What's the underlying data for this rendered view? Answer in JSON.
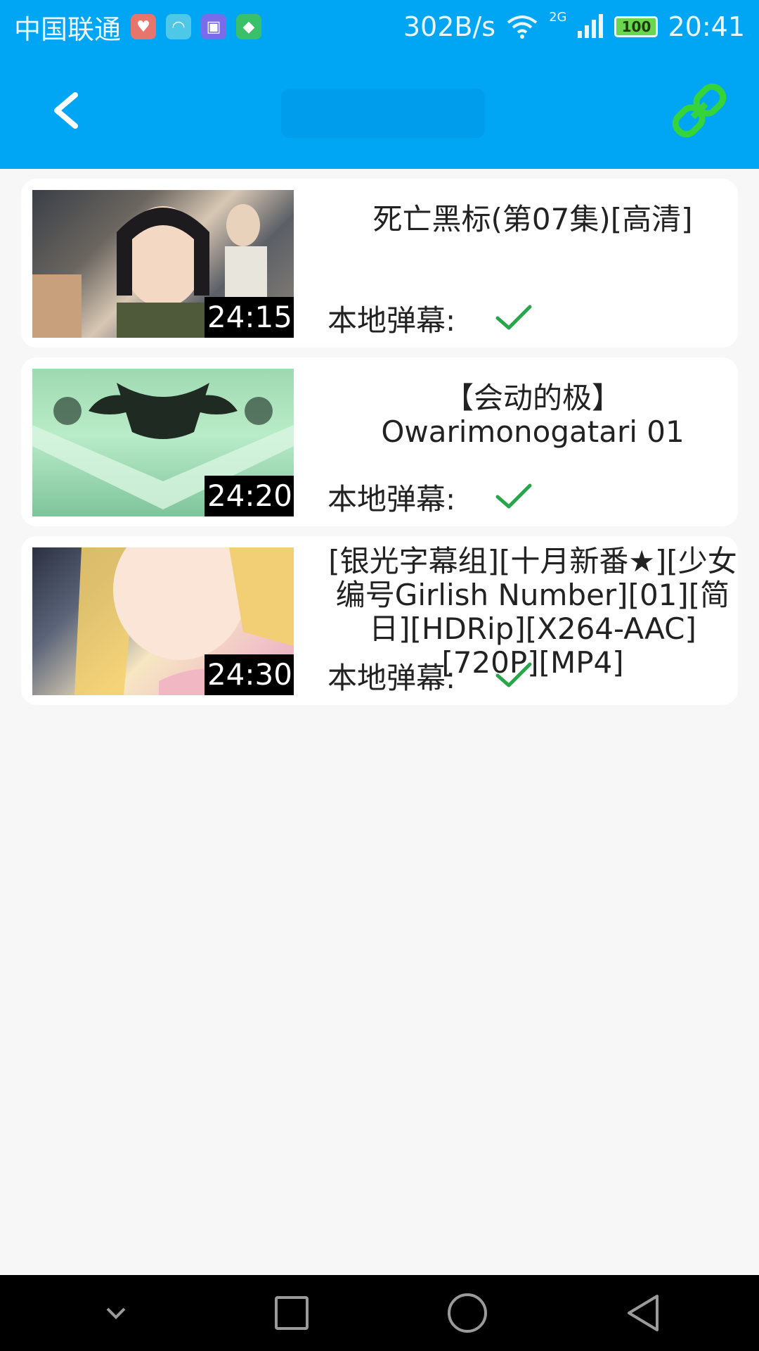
{
  "status_bar": {
    "carrier": "中国联通",
    "speed": "302B/s",
    "network": "2G",
    "battery": "100",
    "time": "20:41"
  },
  "toolbar": {
    "back_icon": "chevron-left-icon",
    "action_icon": "link-icon",
    "action_color": "#35d43b",
    "background": "#00a6f4"
  },
  "videos": [
    {
      "title": "死亡黑标(第07集)[高清]",
      "duration": "24:15",
      "danmaku_label": "本地弹幕:",
      "danmaku_status": "check-icon"
    },
    {
      "title": "【会动的极】Owarimonogatari 01",
      "duration": "24:20",
      "danmaku_label": "本地弹幕:",
      "danmaku_status": "check-icon"
    },
    {
      "title": "[银光字幕组][十月新番★][少女编号Girlish Number][01][简日][HDRip][X264-AAC][720P][MP4]",
      "duration": "24:30",
      "danmaku_label": "本地弹幕:",
      "danmaku_status": "check-icon"
    }
  ],
  "nav_bar": {
    "icons": [
      "chevron-down-icon",
      "recent-apps-icon",
      "home-icon",
      "back-icon"
    ]
  },
  "colors": {
    "accent": "#00a6f4",
    "check": "#27a64b",
    "card": "#ffffff",
    "background": "#f7f7f7"
  }
}
